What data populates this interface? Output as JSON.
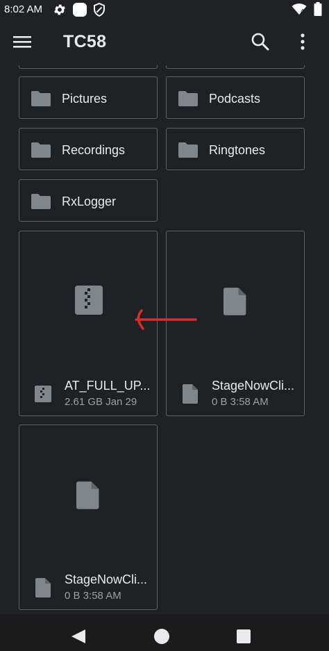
{
  "status_bar": {
    "time": "8:02 AM"
  },
  "app_bar": {
    "title": "TC58"
  },
  "folders": [
    {
      "label": "Pictures"
    },
    {
      "label": "Podcasts"
    },
    {
      "label": "Recordings"
    },
    {
      "label": "Ringtones"
    },
    {
      "label": "RxLogger"
    }
  ],
  "files": [
    {
      "name": "AT_FULL_UP...",
      "meta": "2.61 GB Jan 29",
      "icon": "zip-file-icon"
    },
    {
      "name": "StageNowCli...",
      "meta": "0 B 3:58 AM",
      "icon": "document-icon"
    },
    {
      "name": "StageNowCli...",
      "meta": "0 B 3:58 AM",
      "icon": "document-icon"
    }
  ],
  "colors": {
    "background": "#202124",
    "card_border": "#5f6368",
    "icon_gray": "#80868b",
    "annotation_arrow": "#d32f2f"
  }
}
